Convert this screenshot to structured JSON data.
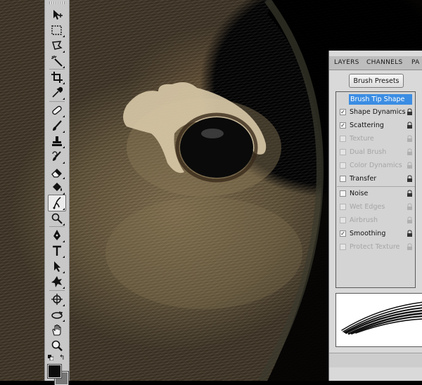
{
  "panel": {
    "tabs": [
      "LAYERS",
      "CHANNELS",
      "PA"
    ],
    "active_tab": "",
    "presets_button": "Brush Presets",
    "header_item": "Brush Tip Shape",
    "options": [
      {
        "label": "Shape Dynamics",
        "checked": true,
        "enabled": true
      },
      {
        "label": "Scattering",
        "checked": true,
        "enabled": true
      },
      {
        "label": "Texture",
        "checked": false,
        "enabled": false
      },
      {
        "label": "Dual Brush",
        "checked": false,
        "enabled": false
      },
      {
        "label": "Color Dynamics",
        "checked": false,
        "enabled": false
      },
      {
        "label": "Transfer",
        "checked": false,
        "enabled": true
      },
      {
        "label": "Noise",
        "checked": false,
        "enabled": true
      },
      {
        "label": "Wet Edges",
        "checked": false,
        "enabled": false
      },
      {
        "label": "Airbrush",
        "checked": false,
        "enabled": false
      },
      {
        "label": "Smoothing",
        "checked": true,
        "enabled": true
      },
      {
        "label": "Protect Texture",
        "checked": false,
        "enabled": false
      }
    ]
  },
  "toolbar": {
    "tools": [
      {
        "name": "move-tool",
        "icon": "move-icon"
      },
      {
        "name": "marquee-tool",
        "icon": "marquee-icon"
      },
      {
        "name": "lasso-tool",
        "icon": "lasso-icon"
      },
      {
        "name": "magic-wand-tool",
        "icon": "magic-wand-icon"
      },
      {
        "name": "crop-tool",
        "icon": "crop-icon"
      },
      {
        "name": "eyedropper-tool",
        "icon": "eyedropper-icon"
      },
      {
        "name": "healing-brush-tool",
        "icon": "bandage-icon"
      },
      {
        "name": "brush-tool",
        "icon": "brush-icon"
      },
      {
        "name": "clone-stamp-tool",
        "icon": "stamp-icon"
      },
      {
        "name": "history-brush-tool",
        "icon": "history-brush-icon"
      },
      {
        "name": "eraser-tool",
        "icon": "eraser-icon"
      },
      {
        "name": "paint-bucket-tool",
        "icon": "bucket-icon"
      },
      {
        "name": "smudge-tool",
        "icon": "smudge-icon"
      },
      {
        "name": "dodge-tool",
        "icon": "dodge-icon"
      },
      {
        "name": "pen-tool",
        "icon": "pen-icon"
      },
      {
        "name": "type-tool",
        "icon": "type-icon"
      },
      {
        "name": "path-selection-tool",
        "icon": "arrow-icon"
      },
      {
        "name": "custom-shape-tool",
        "icon": "shape-icon"
      },
      {
        "name": "3d-rotate-tool",
        "icon": "3d-rotate-icon"
      },
      {
        "name": "3d-orbit-tool",
        "icon": "3d-orbit-icon"
      },
      {
        "name": "hand-tool",
        "icon": "hand-icon"
      },
      {
        "name": "zoom-tool",
        "icon": "zoom-icon"
      }
    ],
    "active_tool": "smudge-tool",
    "foreground_color": "#0b0b0b",
    "background_color": "#777777"
  },
  "colors": {
    "accent": "#3b8de3"
  }
}
